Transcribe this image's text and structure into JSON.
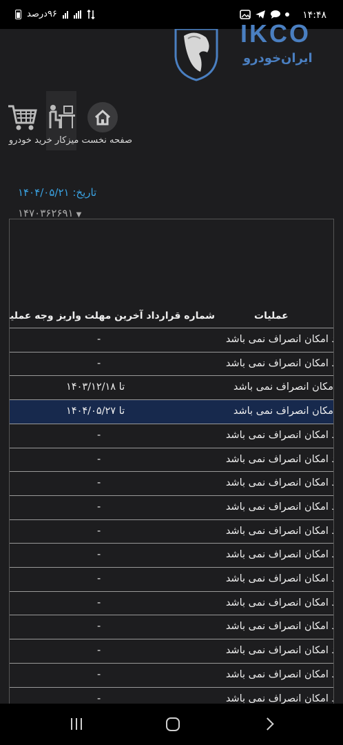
{
  "status_bar": {
    "time": "۱۴:۴۸",
    "battery_text": "۹۶درصد",
    "notification_icons": [
      "dot-icon",
      "chat-icon",
      "telegram-icon",
      "gallery-icon"
    ]
  },
  "logo": {
    "text": "IKCO",
    "subtitle": "ایران‌خودرو"
  },
  "nav": {
    "labels": "صفحه نخست میزکار خرید خودرو",
    "items": [
      "صفحه نخست",
      "میزکار",
      "خرید خودرو"
    ]
  },
  "info": {
    "date": "تاریخ: ۱۴۰۴/۰۵/۲۱",
    "user_id": "۱۴۷۰۳۶۲۶۹۱"
  },
  "table": {
    "header_ops": "عملیات",
    "header_rest": "شماره قرارداد آخرین مهلت واریز وجه عملیات",
    "rows": [
      {
        "op": "د امکان انصراف نمی باشد",
        "deadline": "-"
      },
      {
        "op": "د امکان انصراف نمی باشد",
        "deadline": "-"
      },
      {
        "op": "امکان انصراف نمی باشد",
        "deadline": "تا ۱۴۰۳/۱۲/۱۸"
      },
      {
        "op": "امکان انصراف نمی باشد",
        "deadline": "تا ۱۴۰۴/۰۵/۲۷",
        "selected": true
      },
      {
        "op": "د امکان انصراف نمی باشد",
        "deadline": "-"
      },
      {
        "op": "د امکان انصراف نمی باشد",
        "deadline": "-"
      },
      {
        "op": "د امکان انصراف نمی باشد",
        "deadline": "-"
      },
      {
        "op": "د امکان انصراف نمی باشد",
        "deadline": "-"
      },
      {
        "op": "د امکان انصراف نمی باشد",
        "deadline": "-"
      },
      {
        "op": "د امکان انصراف نمی باشد",
        "deadline": "-"
      },
      {
        "op": "د امکان انصراف نمی باشد",
        "deadline": "-"
      },
      {
        "op": "د امکان انصراف نمی باشد",
        "deadline": "-"
      },
      {
        "op": "د امکان انصراف نمی باشد",
        "deadline": "-"
      },
      {
        "op": "د امکان انصراف نمی باشد",
        "deadline": "-"
      },
      {
        "op": "د امکان انصراف نمی باشد",
        "deadline": "-"
      },
      {
        "op": "د امکان انصراف نمی باشد",
        "deadline": "-"
      }
    ]
  },
  "colors": {
    "background": "#1d1d1f",
    "accent_blue": "#3aa3e3",
    "selected_row": "#17294d",
    "logo_blue": "#4a7fc1"
  },
  "system_nav": [
    "recent-apps",
    "home",
    "back"
  ]
}
